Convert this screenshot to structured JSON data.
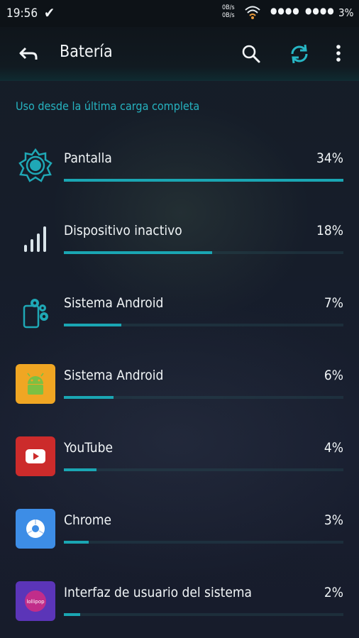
{
  "statusbar": {
    "time": "19:56",
    "check": "✔",
    "net_up": "0B/s",
    "net_down": "0B/s",
    "sig1": "●●●●",
    "sig2": "●●●●",
    "battery": "3%"
  },
  "toolbar": {
    "title": "Batería",
    "back_icon": "back-arrow-icon",
    "search_icon": "search-icon",
    "refresh_icon": "refresh-icon",
    "more_icon": "more-vert-icon"
  },
  "section_title": "Uso desde la última carga completa",
  "accent": "#1aa6b3",
  "items": [
    {
      "name": "Pantalla",
      "percent": "34%",
      "value": 34,
      "icon": "brightness-icon"
    },
    {
      "name": "Dispositivo inactivo",
      "percent": "18%",
      "value": 18,
      "icon": "signal-bars-icon"
    },
    {
      "name": "Sistema Android",
      "percent": "7%",
      "value": 7,
      "icon": "android-system-gear-icon"
    },
    {
      "name": "Sistema Android",
      "percent": "6%",
      "value": 6,
      "icon": "android-app-icon"
    },
    {
      "name": "YouTube",
      "percent": "4%",
      "value": 4,
      "icon": "youtube-icon"
    },
    {
      "name": "Chrome",
      "percent": "3%",
      "value": 3,
      "icon": "chrome-icon"
    },
    {
      "name": "Interfaz de usuario del sistema",
      "percent": "2%",
      "value": 2,
      "icon": "system-ui-lollipop-icon"
    }
  ]
}
